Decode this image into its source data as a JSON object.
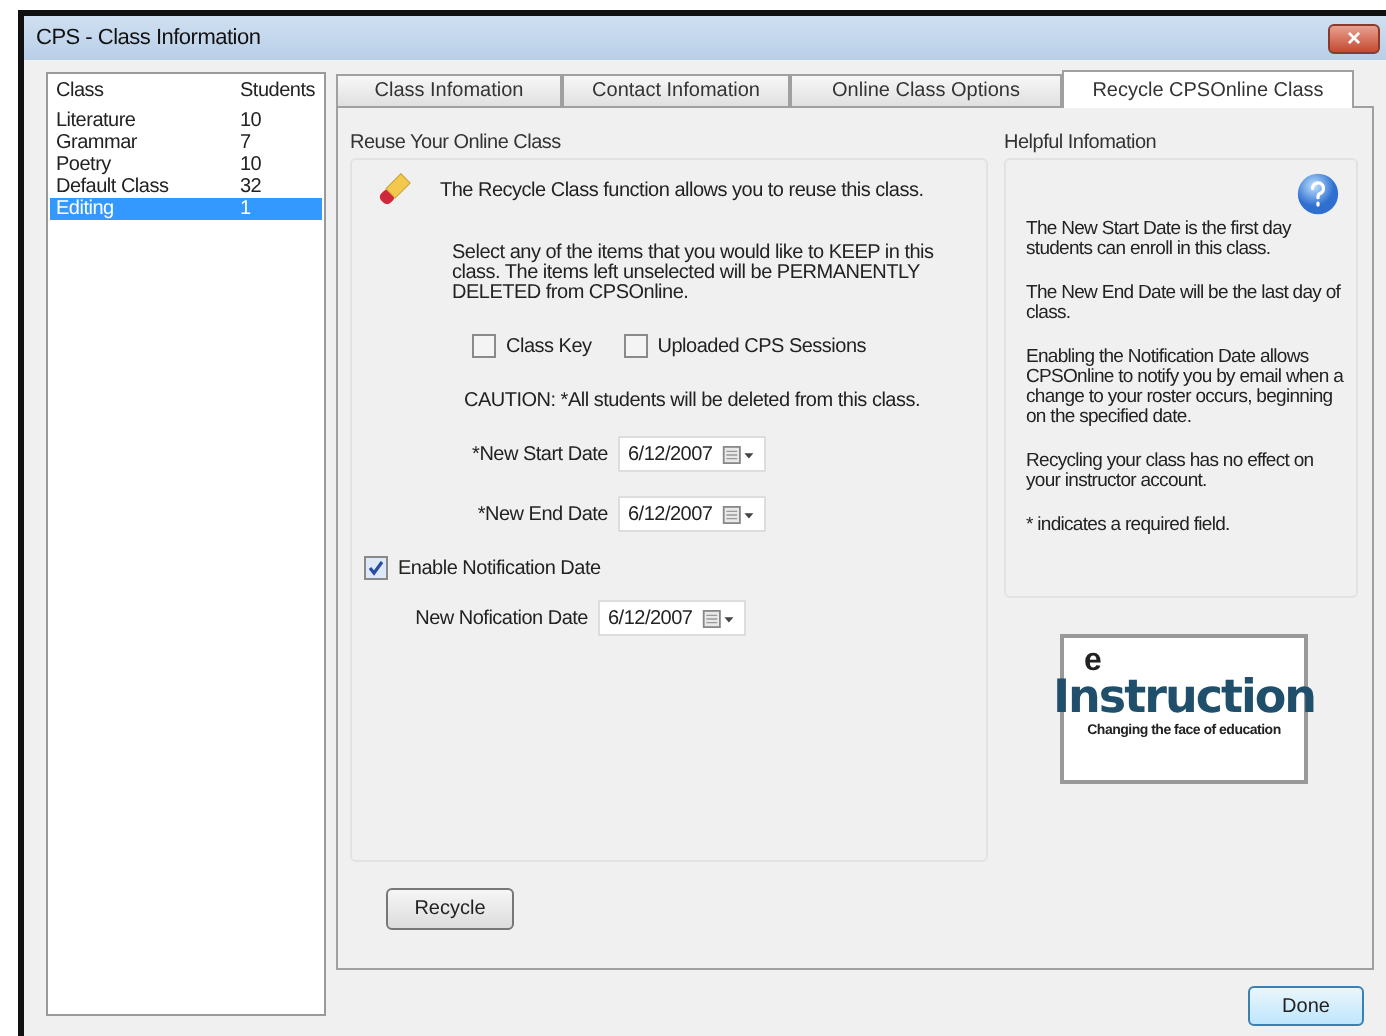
{
  "window": {
    "title": "CPS - Class Information",
    "close": "×"
  },
  "class_list": {
    "columns": [
      "Class",
      "Students"
    ],
    "rows": [
      {
        "name": "Literature",
        "students": "10",
        "selected": false
      },
      {
        "name": "Grammar",
        "students": "7",
        "selected": false
      },
      {
        "name": "Poetry",
        "students": "10",
        "selected": false
      },
      {
        "name": "Default Class",
        "students": "32",
        "selected": false
      },
      {
        "name": "Editing",
        "students": "1",
        "selected": true
      }
    ]
  },
  "tabs": [
    {
      "label": "Class Infomation",
      "selected": false
    },
    {
      "label": "Contact Infomation",
      "selected": false
    },
    {
      "label": "Online Class Options",
      "selected": false
    },
    {
      "label": "Recycle CPSOnline Class",
      "selected": true
    }
  ],
  "reuse": {
    "title": "Reuse Your Online Class",
    "intro": "The Recycle Class function allows you to reuse this class.",
    "instructions": "Select any of the items that you would like to KEEP in this class. The items left unselected will be PERMANENTLY DELETED from CPSOnline.",
    "keep_options": [
      {
        "label": "Class Key",
        "checked": false
      },
      {
        "label": "Uploaded CPS Sessions",
        "checked": false
      }
    ],
    "caution": "CAUTION:  *All students will be deleted from this class.",
    "dates": [
      {
        "label": "*New Start Date",
        "value": "6/12/2007"
      },
      {
        "label": "*New End Date",
        "value": "6/12/2007"
      }
    ],
    "notification": {
      "label": "Enable Notification Date",
      "checked": true
    },
    "notification_date": {
      "label": "New Nofication Date",
      "value": "6/12/2007"
    }
  },
  "help": {
    "title": "Helpful Infomation",
    "paragraphs": [
      "The New Start Date is the first day students can enroll in this class.",
      "The New End Date will be the last day of class.",
      "Enabling the Notification Date allows CPSOnline to notify you by email when a change to your roster occurs, beginning on the specified date.",
      "Recycling your class has no effect on your instructor account.",
      "* indicates a required field."
    ]
  },
  "logo": {
    "letter": "e",
    "wordmark": "Instruction",
    "tagline": "Changing the face of education"
  },
  "buttons": {
    "recycle": "Recycle",
    "done": "Done"
  }
}
